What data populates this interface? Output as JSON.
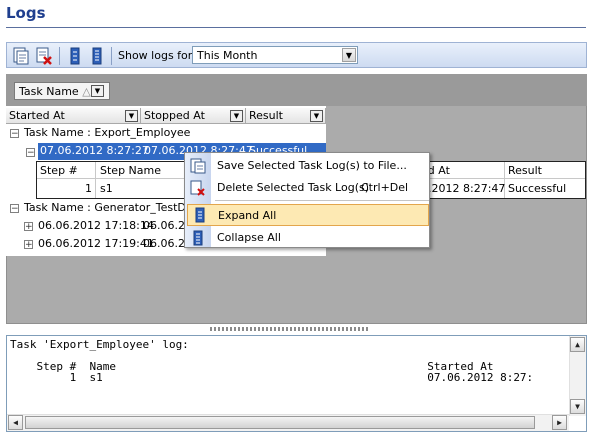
{
  "header": {
    "title": "Logs"
  },
  "toolbar": {
    "show_logs_label": "Show logs for",
    "period_value": "This Month",
    "icons": [
      "view-log-icon",
      "delete-log-icon",
      "expand-all-icon",
      "collapse-all-icon"
    ]
  },
  "grid": {
    "group_by_tag": "Task Name",
    "columns": [
      "Started At",
      "Stopped At",
      "Result"
    ],
    "groups": [
      {
        "label": "Task Name : Export_Employee",
        "rows": [
          {
            "started": "07.06.2012 8:27:27",
            "stopped": "07.06.2012 8:27:47",
            "result": "Successful"
          }
        ]
      },
      {
        "label": "Task Name : Generator_TestDB",
        "rows": [
          {
            "started": "06.06.2012 17:18:14",
            "stopped": "06.06.20"
          },
          {
            "started": "06.06.2012 17:19:41",
            "stopped": "06.06.20"
          }
        ]
      }
    ],
    "detail": {
      "columns": [
        "Step #",
        "Step Name",
        "ed At",
        "Result"
      ],
      "row": {
        "step": "1",
        "name": "s1",
        "started": "2.2012 8:27:47",
        "result": "Successful"
      }
    }
  },
  "context_menu": {
    "items": [
      {
        "label": "Save Selected Task Log(s) to File...",
        "shortcut": ""
      },
      {
        "label": "Delete Selected Task Log(s)",
        "shortcut": "Ctrl+Del"
      },
      {
        "label": "Expand All",
        "shortcut": ""
      },
      {
        "label": "Collapse All",
        "shortcut": ""
      }
    ]
  },
  "log": {
    "lines": [
      "Task 'Export_Employee' log:",
      "",
      "    Step #  Name                                               Started At",
      "         1  s1                                                 07.06.2012 8:27:"
    ]
  }
}
